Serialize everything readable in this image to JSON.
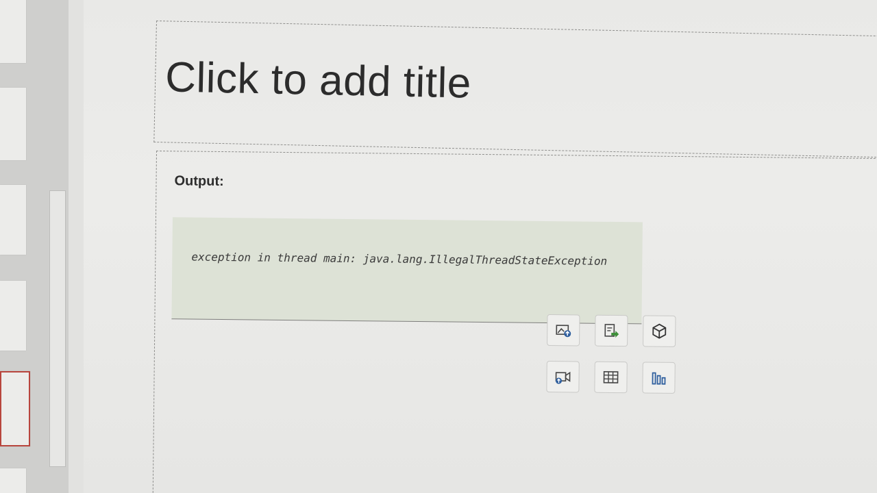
{
  "slide": {
    "title_placeholder": "Click to add title",
    "output_label": "Output:",
    "code_output": "exception in thread main: java.lang.IllegalThreadStateException"
  },
  "insert_buttons": [
    {
      "name": "insert-picture-button",
      "icon": "picture-upload-icon"
    },
    {
      "name": "insert-from-file-button",
      "icon": "file-arrow-icon"
    },
    {
      "name": "insert-3d-model-button",
      "icon": "cube-icon"
    },
    {
      "name": "insert-video-button",
      "icon": "video-camera-icon"
    },
    {
      "name": "insert-table-button",
      "icon": "table-icon"
    },
    {
      "name": "insert-chart-button",
      "icon": "bar-chart-icon"
    }
  ],
  "colors": {
    "accent_blue": "#2f5f9e",
    "accent_green": "#3f8f3a",
    "selected_thumb_border": "#b8453d"
  }
}
